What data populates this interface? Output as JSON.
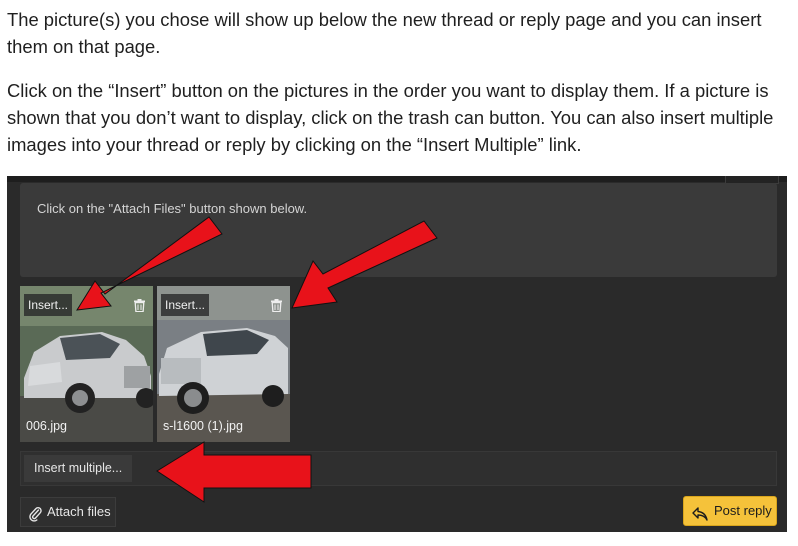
{
  "instructions": {
    "paragraph1": "The picture(s) you chose will show up below the new thread or reply page and you can insert them on that page.",
    "paragraph2": "Click on the “Insert” button on the pictures in the order you want to display them. If a picture is shown that you don’t want to display, click on the trash can button. You can also insert multiple images into your thread or reply by clicking on the “Insert Multiple” link."
  },
  "editor": {
    "text": "Click on the \"Attach Files\" button shown below."
  },
  "attachments": [
    {
      "insert_label": "Insert...",
      "filename": "006.jpg"
    },
    {
      "insert_label": "Insert...",
      "filename": "s-l1600 (1).jpg"
    }
  ],
  "buttons": {
    "insert_multiple": "Insert multiple...",
    "attach_files": "Attach files",
    "post_reply": "Post reply"
  },
  "colors": {
    "annotation_arrow": "#e8121a",
    "post_button": "#f5c23a",
    "panel_bg": "#2a2a2a"
  },
  "icons": [
    "trash-icon",
    "paperclip-icon",
    "reply-arrow-icon"
  ]
}
